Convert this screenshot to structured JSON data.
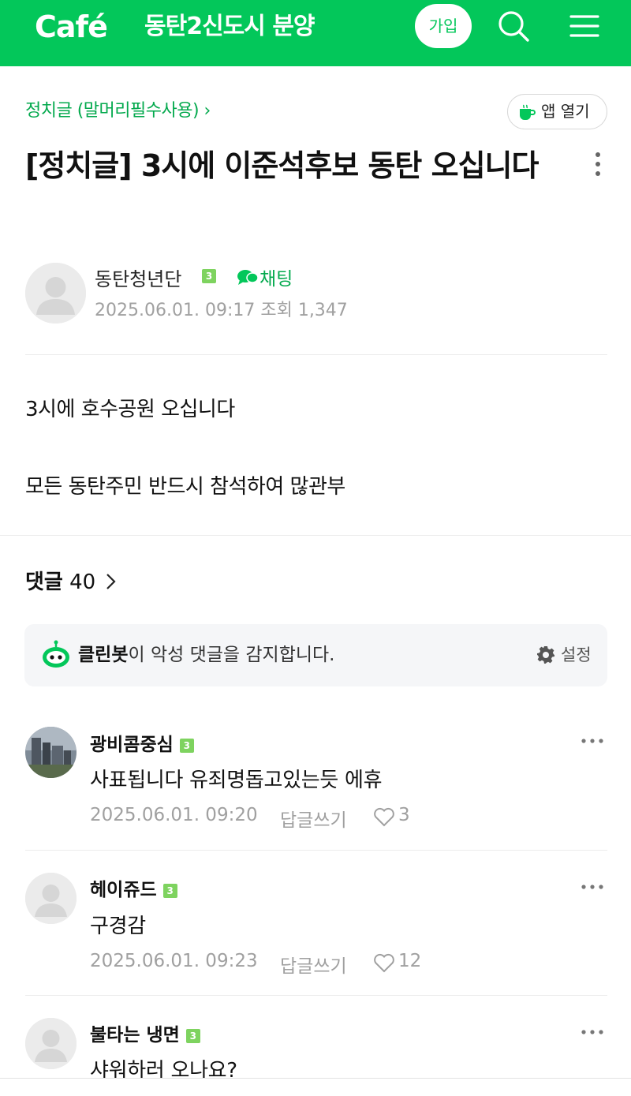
{
  "header": {
    "brand": "Café",
    "cafe_name": "동탄2신도시 분양",
    "join_label": "가입",
    "background": "#03c75a"
  },
  "board": {
    "link_label": "정치글 (말머리필수사용) ›"
  },
  "app_open": {
    "label": "앱 열기"
  },
  "post": {
    "title": "[정치글] 3시에 이준석후보 동탄 오십니다",
    "author": "동탄청년단",
    "level": "3",
    "chat_label": "채팅",
    "meta": "2025.06.01. 09:17  조회 1,347",
    "body": [
      "3시에 호수공원 오십니다",
      "모든 동탄주민 반드시 참석하여 많관부"
    ]
  },
  "comments_header": {
    "label": "댓글",
    "count": "40"
  },
  "cleanbot": {
    "name": "클린봇",
    "text": "이 악성 댓글을 감지합니다.",
    "settings_label": "설정"
  },
  "comments": [
    {
      "author": "광비콤중심",
      "level": "3",
      "text": "사표됩니다 유죄명돕고있는듯 에휴",
      "date": "2025.06.01. 09:20",
      "reply_label": "답글쓰기",
      "likes": "3"
    },
    {
      "author": "헤이쥬드",
      "level": "3",
      "text": "구경감",
      "date": "2025.06.01. 09:23",
      "reply_label": "답글쓰기",
      "likes": "12"
    },
    {
      "author": "불타는 냉면",
      "level": "3",
      "text": "샤워하러 오나요?"
    }
  ],
  "icons": [
    "search-icon",
    "menu-icon",
    "cup-icon",
    "more-vertical-icon",
    "chat-icon",
    "bot-icon",
    "gear-icon",
    "heart-icon",
    "more-horizontal-icon",
    "chevron-right-icon"
  ],
  "colors": {
    "brand_green": "#03c75a",
    "link_green": "#03a94d",
    "badge_green": "#7ed35f"
  }
}
